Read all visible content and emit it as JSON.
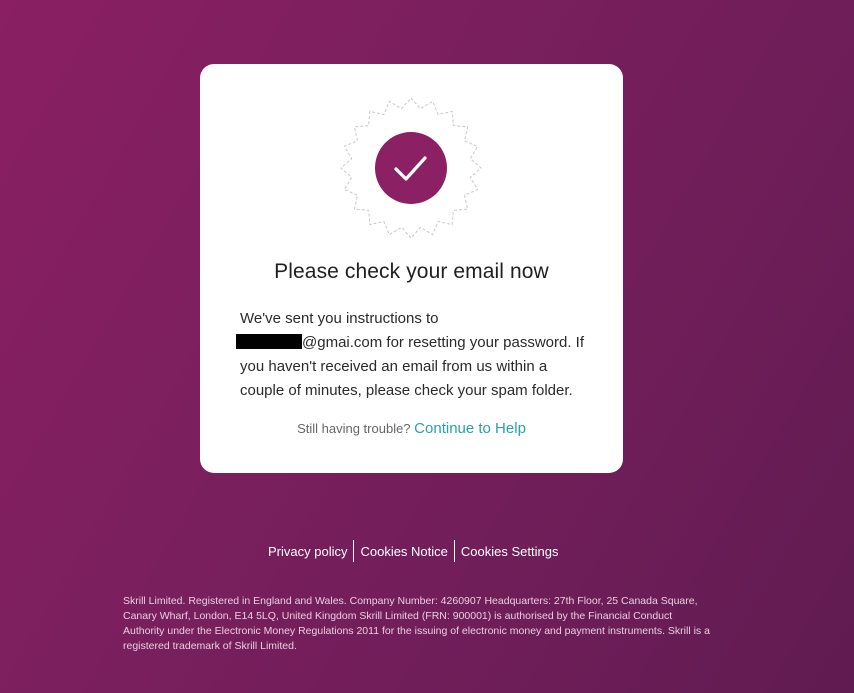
{
  "card": {
    "title": "Please check your email now",
    "message_line1": "We've sent you instructions to",
    "email_suffix": "@gmai.com for resetting your password. If you haven't received an email from us within a couple of minutes, please check your spam folder.",
    "help_prefix": "Still having trouble?",
    "help_link": "Continue to Help",
    "badge_icon": "check-icon",
    "accent_color": "#8b2065",
    "link_color": "#2ba0a8"
  },
  "footer": {
    "links": [
      "Privacy policy",
      "Cookies Notice",
      "Cookies Settings"
    ],
    "legal": "Skrill Limited. Registered in England and Wales. Company Number: 4260907 Headquarters: 27th Floor, 25 Canada Square, Canary Wharf, London, E14 5LQ, United Kingdom Skrill Limited (FRN: 900001) is authorised by the Financial Conduct Authority under the Electronic Money Regulations 2011 for the issuing of electronic money and payment instruments. Skrill is a registered trademark of Skrill Limited."
  }
}
